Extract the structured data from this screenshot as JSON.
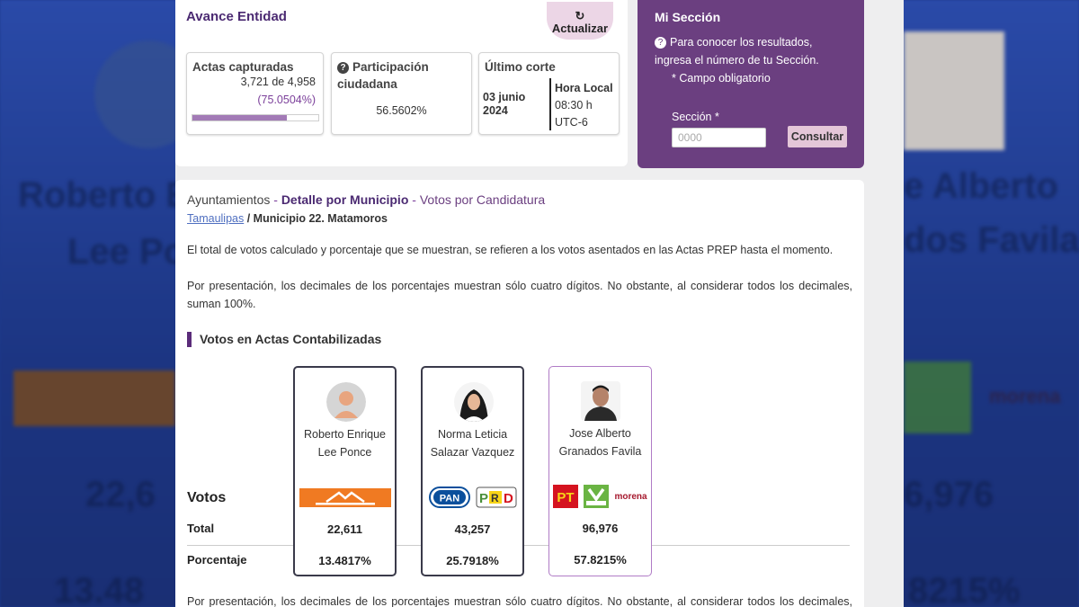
{
  "background": {
    "name_left_1": "Roberto E",
    "name_left_2": "Lee Po",
    "name_right_1": "e Alberto",
    "name_right_2": "dos Favila",
    "num_left": "22,6",
    "num_right": "6,976",
    "pct_left": "13.48",
    "pct_right": "8215%",
    "morena": "morena"
  },
  "header": {
    "title": "Avance Entidad",
    "refresh_label": "Actualizar"
  },
  "stats": {
    "actas_title": "Actas capturadas",
    "actas_count": "3,721 de 4,958",
    "actas_pct": "(75.0504%)",
    "actas_progress": 0.750504,
    "participacion_title": "Participación ciudadana",
    "participacion_value": "56.5602%",
    "corte_title": "Último corte",
    "corte_date": "03 junio 2024",
    "corte_hora_label": "Hora Local",
    "corte_time": "08:30 h",
    "corte_tz": "UTC-6"
  },
  "sidebar": {
    "title": "Mi Sección",
    "info": "Para conocer los resultados, ingresa el número de tu Sección.",
    "required": "* Campo obligatorio",
    "label": "Sección *",
    "placeholder": "0000",
    "button": "Consultar"
  },
  "breadcrumb": {
    "part1": "Ayuntamientos",
    "sep": " - ",
    "part2": "Detalle por Municipio",
    "part3": "Votos por Candidatura"
  },
  "path": {
    "link": "Tamaulipas",
    "rest": " / Municipio 22. Matamoros"
  },
  "text": {
    "p1": "El total de votos calculado y porcentaje que se muestran, se refieren a los votos asentados en las Actas PREP hasta el momento.",
    "p2": "Por presentación, los decimales de los porcentajes muestran sólo cuatro dígitos. No obstante, al considerar todos los decimales, suman 100%.",
    "p3": "Por presentación, los decimales de los porcentajes muestran sólo cuatro dígitos. No obstante, al considerar todos los decimales, suman 100%."
  },
  "section": {
    "title": "Votos en Actas Contabilizadas",
    "row_votos": "Votos",
    "row_total": "Total",
    "row_pct": "Porcentaje"
  },
  "candidates": [
    {
      "name": "Roberto Enrique Lee Ponce",
      "total": "22,611",
      "pct": "13.4817%",
      "parties": [
        "MC"
      ]
    },
    {
      "name": "Norma Leticia Salazar Vazquez",
      "total": "43,257",
      "pct": "25.7918%",
      "parties": [
        "PAN",
        "PRD"
      ]
    },
    {
      "name": "Jose Alberto Granados Favila",
      "total": "96,976",
      "pct": "57.8215%",
      "parties": [
        "PT",
        "VERDE",
        "morena"
      ]
    }
  ],
  "colors": {
    "brand_purple": "#6b3f80",
    "accent_dark_purple": "#4b2a72",
    "mc_orange": "#f07a22",
    "pan_blue": "#0b4f9c",
    "prd_yellow": "#f7d417",
    "pt_red": "#d5131f",
    "verde_green": "#6ab443",
    "morena_maroon": "#a6192e"
  }
}
